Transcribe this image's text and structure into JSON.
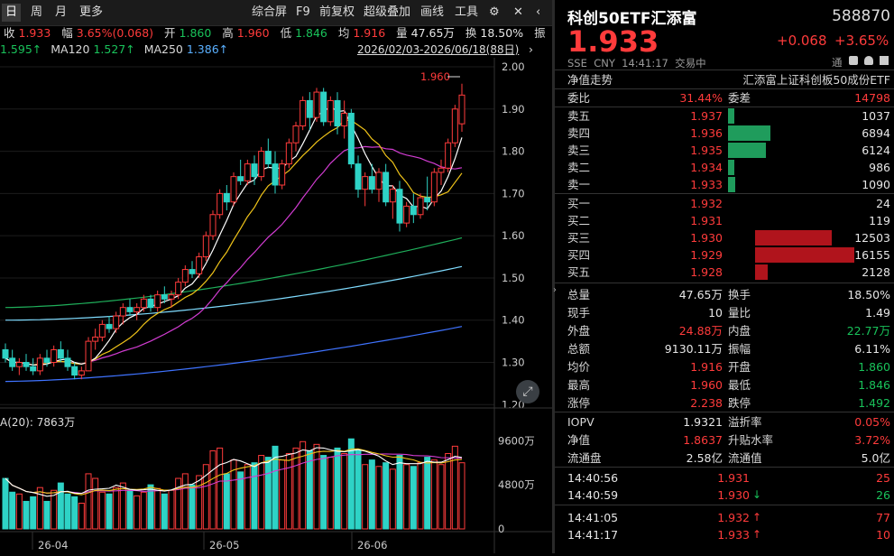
{
  "toolbar": {
    "tabs": [
      "日",
      "周",
      "月",
      "更多"
    ],
    "tools": [
      "综合屏",
      "F9",
      "前复权",
      "超级叠加",
      "画线",
      "工具"
    ]
  },
  "stats": {
    "close_label": "收",
    "close": "1.933",
    "amp_label": "幅",
    "amp": "3.65%(0.068)",
    "open_label": "开",
    "open": "1.860",
    "high_label": "高",
    "high": "1.960",
    "low_label": "低",
    "low": "1.846",
    "avg_label": "均",
    "avg": "1.916",
    "vol_label": "量",
    "vol": "47.65万",
    "turn_label": "换",
    "turn": "18.50%",
    "more_label": "振"
  },
  "ma": {
    "ma60": "1.595↑",
    "ma120_label": "MA120",
    "ma120": "1.527↑",
    "ma250_label": "MA250",
    "ma250": "1.386↑",
    "range": "2026/02/03-2026/06/18(88日)"
  },
  "chart_data": {
    "type": "candlestick",
    "y_ticks": [
      "2.00",
      "1.90",
      "1.80",
      "1.70",
      "1.60",
      "1.50",
      "1.40",
      "1.30",
      "1.20"
    ],
    "ylim": [
      1.2,
      2.0
    ],
    "high_annotation": "1.960",
    "volume_label": "A(20): 7863万",
    "vol_ticks": [
      "9600万",
      "4800万",
      "0"
    ],
    "x_labels": [
      "26-04",
      "26-05",
      "26-06"
    ],
    "ohlc": [
      [
        1.33,
        1.345,
        1.3,
        1.31
      ],
      [
        1.31,
        1.33,
        1.28,
        1.29
      ],
      [
        1.29,
        1.31,
        1.27,
        1.3
      ],
      [
        1.3,
        1.32,
        1.28,
        1.29
      ],
      [
        1.29,
        1.31,
        1.27,
        1.28
      ],
      [
        1.28,
        1.32,
        1.27,
        1.31
      ],
      [
        1.31,
        1.33,
        1.29,
        1.3
      ],
      [
        1.3,
        1.34,
        1.29,
        1.33
      ],
      [
        1.33,
        1.35,
        1.3,
        1.31
      ],
      [
        1.31,
        1.33,
        1.28,
        1.29
      ],
      [
        1.29,
        1.3,
        1.26,
        1.27
      ],
      [
        1.27,
        1.29,
        1.26,
        1.28
      ],
      [
        1.28,
        1.36,
        1.28,
        1.35
      ],
      [
        1.35,
        1.38,
        1.33,
        1.36
      ],
      [
        1.36,
        1.4,
        1.35,
        1.39
      ],
      [
        1.39,
        1.41,
        1.37,
        1.38
      ],
      [
        1.38,
        1.42,
        1.37,
        1.41
      ],
      [
        1.41,
        1.44,
        1.39,
        1.43
      ],
      [
        1.43,
        1.45,
        1.41,
        1.42
      ],
      [
        1.42,
        1.44,
        1.4,
        1.43
      ],
      [
        1.43,
        1.46,
        1.42,
        1.45
      ],
      [
        1.45,
        1.46,
        1.42,
        1.43
      ],
      [
        1.43,
        1.47,
        1.42,
        1.46
      ],
      [
        1.46,
        1.48,
        1.44,
        1.45
      ],
      [
        1.45,
        1.47,
        1.43,
        1.46
      ],
      [
        1.46,
        1.5,
        1.45,
        1.49
      ],
      [
        1.49,
        1.53,
        1.48,
        1.52
      ],
      [
        1.52,
        1.54,
        1.5,
        1.51
      ],
      [
        1.51,
        1.56,
        1.5,
        1.55
      ],
      [
        1.55,
        1.61,
        1.54,
        1.6
      ],
      [
        1.6,
        1.66,
        1.59,
        1.65
      ],
      [
        1.65,
        1.71,
        1.64,
        1.7
      ],
      [
        1.7,
        1.72,
        1.66,
        1.68
      ],
      [
        1.68,
        1.75,
        1.67,
        1.74
      ],
      [
        1.74,
        1.78,
        1.72,
        1.73
      ],
      [
        1.73,
        1.78,
        1.72,
        1.77
      ],
      [
        1.77,
        1.79,
        1.72,
        1.74
      ],
      [
        1.74,
        1.81,
        1.73,
        1.8
      ],
      [
        1.8,
        1.83,
        1.76,
        1.77
      ],
      [
        1.77,
        1.8,
        1.7,
        1.72
      ],
      [
        1.72,
        1.78,
        1.71,
        1.77
      ],
      [
        1.77,
        1.83,
        1.76,
        1.82
      ],
      [
        1.82,
        1.87,
        1.8,
        1.86
      ],
      [
        1.86,
        1.93,
        1.85,
        1.92
      ],
      [
        1.92,
        1.94,
        1.85,
        1.88
      ],
      [
        1.88,
        1.95,
        1.87,
        1.94
      ],
      [
        1.94,
        1.95,
        1.86,
        1.87
      ],
      [
        1.87,
        1.93,
        1.86,
        1.92
      ],
      [
        1.92,
        1.94,
        1.84,
        1.86
      ],
      [
        1.86,
        1.92,
        1.83,
        1.89
      ],
      [
        1.89,
        1.9,
        1.76,
        1.77
      ],
      [
        1.77,
        1.79,
        1.69,
        1.71
      ],
      [
        1.71,
        1.75,
        1.67,
        1.74
      ],
      [
        1.74,
        1.77,
        1.7,
        1.71
      ],
      [
        1.71,
        1.76,
        1.68,
        1.75
      ],
      [
        1.75,
        1.77,
        1.67,
        1.68
      ],
      [
        1.68,
        1.72,
        1.64,
        1.71
      ],
      [
        1.71,
        1.73,
        1.61,
        1.63
      ],
      [
        1.63,
        1.68,
        1.62,
        1.67
      ],
      [
        1.67,
        1.7,
        1.63,
        1.65
      ],
      [
        1.65,
        1.7,
        1.64,
        1.69
      ],
      [
        1.69,
        1.74,
        1.66,
        1.68
      ],
      [
        1.68,
        1.76,
        1.67,
        1.75
      ],
      [
        1.75,
        1.78,
        1.72,
        1.76
      ],
      [
        1.76,
        1.83,
        1.75,
        1.82
      ],
      [
        1.82,
        1.91,
        1.81,
        1.9
      ],
      [
        1.865,
        1.96,
        1.846,
        1.933
      ]
    ],
    "volumes": [
      55,
      40,
      38,
      30,
      35,
      45,
      30,
      42,
      50,
      38,
      35,
      28,
      60,
      55,
      40,
      38,
      45,
      50,
      42,
      36,
      40,
      48,
      44,
      38,
      42,
      55,
      60,
      48,
      58,
      70,
      85,
      88,
      60,
      75,
      62,
      70,
      72,
      80,
      78,
      90,
      75,
      82,
      88,
      95,
      85,
      92,
      80,
      78,
      88,
      82,
      98,
      85,
      70,
      75,
      68,
      72,
      65,
      80,
      70,
      68,
      72,
      78,
      75,
      70,
      82,
      90,
      72
    ]
  },
  "right": {
    "name": "科创50ETF汇添富",
    "code": "588870",
    "price": "1.933",
    "change": "+0.068",
    "pct": "+3.65%",
    "exch": "SSE",
    "cur": "CNY",
    "time": "14:41:17",
    "status": "交易中",
    "tong": "通",
    "nav_link": "净值走势",
    "index_name": "汇添富上证科创板50成份ETF",
    "weibi_label": "委比",
    "weibi": "31.44%",
    "weicha_label": "委差",
    "weicha": "14798",
    "asks": [
      {
        "label": "卖五",
        "price": "1.937",
        "vol": "1037",
        "bar": 0.06
      },
      {
        "label": "卖四",
        "price": "1.936",
        "vol": "6894",
        "bar": 0.43
      },
      {
        "label": "卖三",
        "price": "1.935",
        "vol": "6124",
        "bar": 0.38
      },
      {
        "label": "卖二",
        "price": "1.934",
        "vol": "986",
        "bar": 0.06
      },
      {
        "label": "卖一",
        "price": "1.933",
        "vol": "1090",
        "bar": 0.07
      }
    ],
    "bids": [
      {
        "label": "买一",
        "price": "1.932",
        "vol": "24",
        "bar": 0.0
      },
      {
        "label": "买二",
        "price": "1.931",
        "vol": "119",
        "bar": 0.0
      },
      {
        "label": "买三",
        "price": "1.930",
        "vol": "12503",
        "bar": 0.77
      },
      {
        "label": "买四",
        "price": "1.929",
        "vol": "16155",
        "bar": 1.0
      },
      {
        "label": "买五",
        "price": "1.928",
        "vol": "2128",
        "bar": 0.13
      }
    ],
    "stats": [
      {
        "l1": "总量",
        "v1": "47.65万",
        "c1": "white",
        "l2": "换手",
        "v2": "18.50%",
        "c2": "white"
      },
      {
        "l1": "现手",
        "v1": "10",
        "c1": "white",
        "l2": "量比",
        "v2": "1.49",
        "c2": "white"
      },
      {
        "l1": "外盘",
        "v1": "24.88万",
        "c1": "red",
        "l2": "内盘",
        "v2": "22.77万",
        "c2": "green"
      },
      {
        "l1": "总额",
        "v1": "9130.11万",
        "c1": "white",
        "l2": "振幅",
        "v2": "6.11%",
        "c2": "white"
      },
      {
        "l1": "均价",
        "v1": "1.916",
        "c1": "red",
        "l2": "开盘",
        "v2": "1.860",
        "c2": "green"
      },
      {
        "l1": "最高",
        "v1": "1.960",
        "c1": "red",
        "l2": "最低",
        "v2": "1.846",
        "c2": "green"
      },
      {
        "l1": "涨停",
        "v1": "2.238",
        "c1": "red",
        "l2": "跌停",
        "v2": "1.492",
        "c2": "green"
      }
    ],
    "etf": [
      {
        "l1": "IOPV",
        "v1": "1.9321",
        "c1": "white",
        "l2": "溢折率",
        "v2": "0.05%",
        "c2": "red"
      },
      {
        "l1": "净值",
        "v1": "1.8637",
        "c1": "red",
        "l2": "升贴水率",
        "v2": "3.72%",
        "c2": "red"
      },
      {
        "l1": "流通盘",
        "v1": "2.58亿",
        "c1": "white",
        "l2": "流通值",
        "v2": "5.0亿",
        "c2": "white"
      }
    ],
    "trades": [
      {
        "time": "14:40:56",
        "price": "1.931",
        "arrow": "",
        "vol": "25",
        "pc": "red",
        "vc": "red"
      },
      {
        "time": "14:40:59",
        "price": "1.930",
        "arrow": "↓",
        "vol": "26",
        "pc": "red",
        "vc": "green"
      },
      {
        "time": "14:41:05",
        "price": "1.932",
        "arrow": "↑",
        "vol": "77",
        "pc": "red",
        "vc": "red"
      },
      {
        "time": "14:41:17",
        "price": "1.933",
        "arrow": "↑",
        "vol": "10",
        "pc": "red",
        "vc": "red"
      }
    ]
  }
}
